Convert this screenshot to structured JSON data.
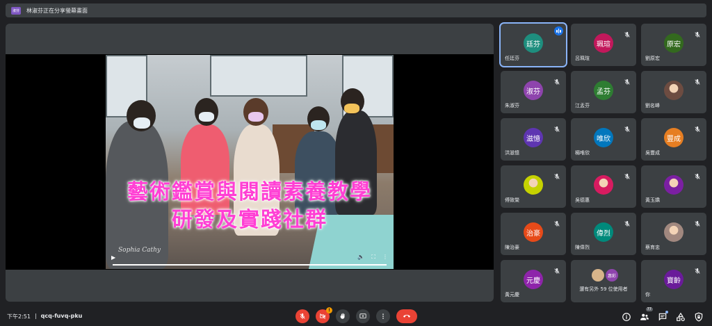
{
  "topbar": {
    "presenter_avatar": "淑芬",
    "text": "林淑芬正在分享螢幕畫面"
  },
  "video": {
    "caption_line1": "藝術鑑賞與閱讀素養教學",
    "caption_line2": "研發及實踐社群",
    "watermark": "Sophia Cathy",
    "progress": 1.0
  },
  "participants": [
    {
      "initials": "廷芬",
      "name": "任廷芬",
      "color": "#1e8e7e",
      "speaking": true,
      "muted": false
    },
    {
      "initials": "珮瑄",
      "name": "呂珮瑄",
      "color": "#c2185b",
      "speaking": false,
      "muted": true
    },
    {
      "initials": "原宏",
      "name": "劉原宏",
      "color": "#33691e",
      "speaking": false,
      "muted": true
    },
    {
      "initials": "淑芬",
      "name": "朱淑芬",
      "color": "#8e44ad",
      "speaking": false,
      "muted": true
    },
    {
      "initials": "孟芬",
      "name": "江孟芬",
      "color": "#2e7d32",
      "speaking": false,
      "muted": true
    },
    {
      "initials": "",
      "name": "劉名峰",
      "color": "#6d4c41",
      "speaking": false,
      "muted": true,
      "photo": true
    },
    {
      "initials": "滋憶",
      "name": "洪滋憶",
      "color": "#5e35b1",
      "speaking": false,
      "muted": true
    },
    {
      "initials": "唯欣",
      "name": "楊唯欣",
      "color": "#0277bd",
      "speaking": false,
      "muted": true
    },
    {
      "initials": "豐成",
      "name": "吳豐成",
      "color": "#e67e22",
      "speaking": false,
      "muted": true
    },
    {
      "initials": "",
      "name": "傅致榮",
      "color": "#c6d200",
      "speaking": false,
      "muted": true,
      "photo": true
    },
    {
      "initials": "",
      "name": "吳德惠",
      "color": "#d81b60",
      "speaking": false,
      "muted": true,
      "photo": true
    },
    {
      "initials": "",
      "name": "黃玉嬌",
      "color": "#7b1fa2",
      "speaking": false,
      "muted": true,
      "photo": true
    },
    {
      "initials": "治豪",
      "name": "陳治豪",
      "color": "#e64a19",
      "speaking": false,
      "muted": true
    },
    {
      "initials": "偉烈",
      "name": "陳偉烈",
      "color": "#00897b",
      "speaking": false,
      "muted": true
    },
    {
      "initials": "",
      "name": "蔡育忠",
      "color": "#a1887f",
      "speaking": false,
      "muted": true,
      "photo": true
    },
    {
      "initials": "元慶",
      "name": "黃元慶",
      "color": "#8e24aa",
      "speaking": false,
      "muted": true
    },
    {
      "others": true,
      "avatar_small": "惠彩",
      "text": "還有另外 59 位使用者"
    },
    {
      "initials": "寶齡",
      "name": "你",
      "color": "#6a1b9a",
      "speaking": false,
      "muted": true
    }
  ],
  "bottombar": {
    "time": "下午2:51",
    "separator": "|",
    "meeting_code": "qcq-fuvq-pku",
    "warning_badge": "!",
    "people_count": "77"
  },
  "colors": {
    "bg": "#202124",
    "tile": "#3c4043",
    "accent": "#8ab4f8",
    "red": "#ea4335"
  }
}
